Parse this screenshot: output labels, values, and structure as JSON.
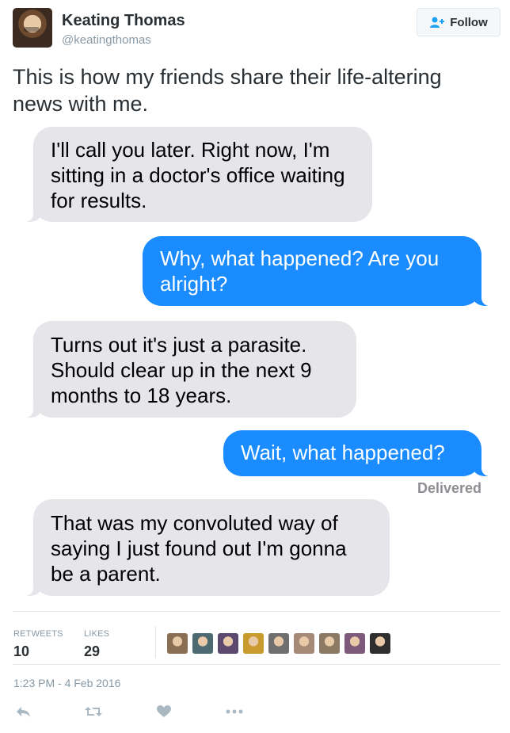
{
  "header": {
    "name": "Keating Thomas",
    "handle": "@keatingthomas",
    "follow_label": "Follow"
  },
  "tweet": {
    "text": "This is how my friends share their life-altering news with me."
  },
  "messages": [
    {
      "direction": "in",
      "text": "I'll call you later. Right now, I'm sitting in a doctor's office waiting for results."
    },
    {
      "direction": "out",
      "text": "Why, what happened? Are you alright?"
    },
    {
      "direction": "in",
      "text": "Turns out it's just a parasite. Should clear up in the next 9 months to 18 years."
    },
    {
      "direction": "out",
      "text": "Wait, what happened?"
    },
    {
      "direction": "in",
      "text": "That was my convoluted way of saying I just found out I'm gonna be a parent."
    }
  ],
  "delivered_label": "Delivered",
  "stats": {
    "retweets_label": "RETWEETS",
    "retweets_value": "10",
    "likes_label": "LIKES",
    "likes_value": "29"
  },
  "liker_avatar_colors": [
    "#8a6f55",
    "#4d6a73",
    "#5c4a6e",
    "#c99a2e",
    "#6f6f6f",
    "#a58a78",
    "#8c7a65",
    "#7d5a7a",
    "#2f2f2f"
  ],
  "timestamp": "1:23 PM - 4 Feb 2016",
  "colors": {
    "incoming_bubble": "#e5e5ea",
    "outgoing_bubble": "#1a8cff",
    "twitter_blue": "#1da1f2",
    "muted_text": "#8899a6",
    "action_icon": "#aab8c2"
  },
  "icons": {
    "follow": "add-user-icon",
    "reply": "reply-icon",
    "retweet": "retweet-icon",
    "like": "heart-icon",
    "more": "more-icon"
  }
}
